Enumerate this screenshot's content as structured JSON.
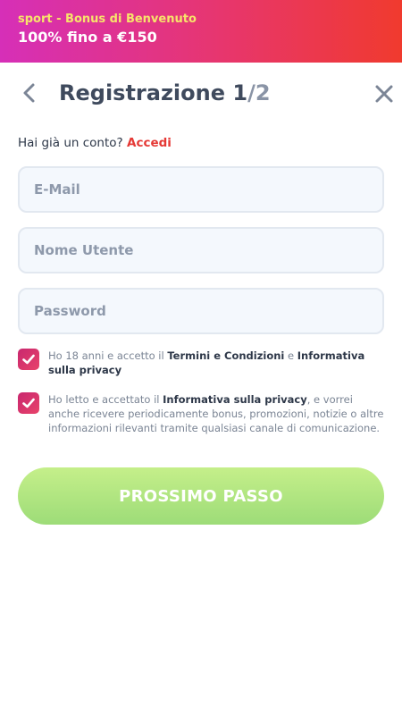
{
  "banner": {
    "line1": "sport - Bonus di Benvenuto",
    "line2": "100% fino a €150",
    "colors": {
      "gradient_start": "#d62fb8",
      "gradient_end": "#f03a2e",
      "line1": "#f7e36a"
    }
  },
  "header": {
    "title": "Registrazione",
    "step_current": "1",
    "step_total": "/2",
    "back_icon": "chevron-left-icon",
    "close_icon": "close-icon"
  },
  "login": {
    "prompt": "Hai già un conto?",
    "link": "Accedi",
    "link_color": "#e53935"
  },
  "form": {
    "email_placeholder": "E-Mail",
    "username_placeholder": "Nome Utente",
    "password_placeholder": "Password",
    "email_value": "",
    "username_value": "",
    "password_value": ""
  },
  "consents": [
    {
      "checked": true,
      "text_1": "Ho 18 anni e accetto il ",
      "link_1": "Termini e Condizioni",
      "text_2": " e ",
      "link_2": "Informativa sulla privacy"
    },
    {
      "checked": true,
      "text_1": "Ho letto e accettato il ",
      "link_1": "Informativa sulla privacy",
      "text_2": ", e vorrei anche ricevere periodicamente bonus, promozioni, notizie o altre informazioni rilevanti tramite qualsiasi canale di comunicazione."
    }
  ],
  "cta": {
    "label": "PROSSIMO PASSO",
    "color": "#9ddc78"
  }
}
